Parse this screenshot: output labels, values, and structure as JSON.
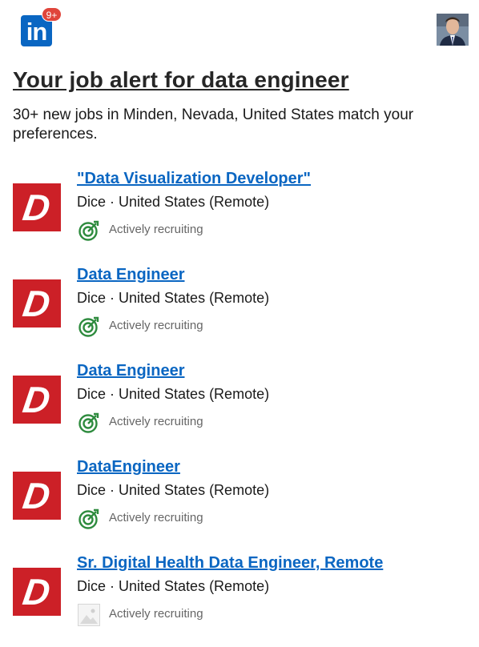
{
  "header": {
    "logo_text": "in",
    "notification_badge": "9+",
    "brand_color": "#0a66c2",
    "badge_color": "#e0453b"
  },
  "title": "Your job alert for data engineer",
  "subtitle": "30+ new jobs in Minden, Nevada, United States match your preferences.",
  "jobs": [
    {
      "title": "\"Data Visualization Developer\"",
      "meta": "Dice · United States (Remote)",
      "status": "Actively recruiting",
      "logo_letter": "D",
      "icon": "target-icon"
    },
    {
      "title": "Data Engineer",
      "meta": "Dice · United States (Remote)",
      "status": "Actively recruiting",
      "logo_letter": "D",
      "icon": "target-icon"
    },
    {
      "title": "Data Engineer",
      "meta": "Dice · United States (Remote)",
      "status": "Actively recruiting",
      "logo_letter": "D",
      "icon": "target-icon"
    },
    {
      "title": "DataEngineer",
      "meta": "Dice · United States (Remote)",
      "status": "Actively recruiting",
      "logo_letter": "D",
      "icon": "target-icon"
    },
    {
      "title": "Sr. Digital Health Data Engineer, Remote",
      "meta": "Dice · United States (Remote)",
      "status": "Actively recruiting",
      "logo_letter": "D",
      "icon": "broken-image-icon"
    }
  ],
  "colors": {
    "dice_red": "#cc2027",
    "link_blue": "#0a66c2",
    "recruit_green": "#2e8b3e"
  }
}
